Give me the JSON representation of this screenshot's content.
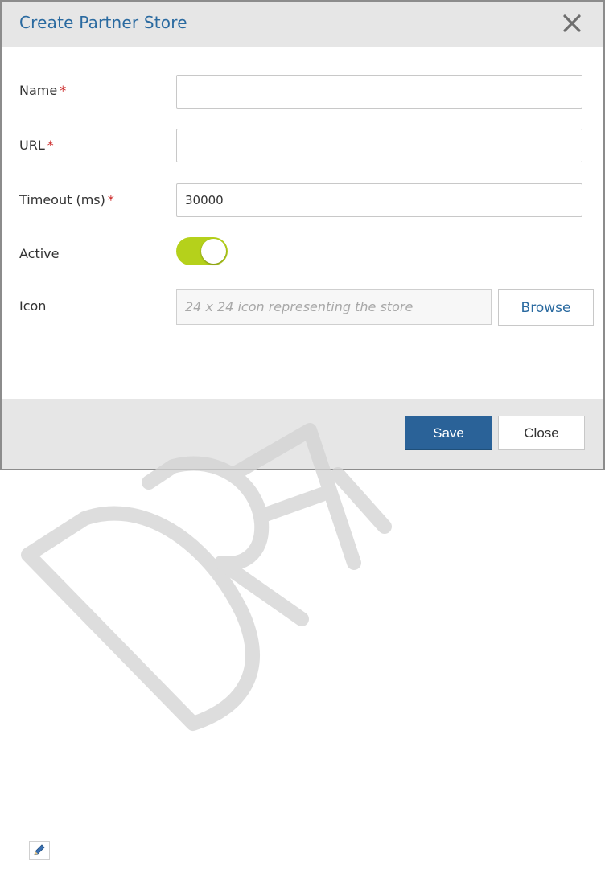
{
  "dialog": {
    "title": "Create Partner Store",
    "close_icon": "close-icon"
  },
  "form": {
    "name": {
      "label": "Name",
      "required_mark": "*",
      "value": ""
    },
    "url": {
      "label": "URL",
      "required_mark": "*",
      "value": ""
    },
    "timeout": {
      "label": "Timeout (ms)",
      "required_mark": "*",
      "value": "30000"
    },
    "active": {
      "label": "Active",
      "checked": true
    },
    "icon": {
      "label": "Icon",
      "placeholder": "24 x 24 icon representing the store",
      "browse_label": "Browse"
    }
  },
  "footer": {
    "save_label": "Save",
    "close_label": "Close"
  },
  "watermark": {
    "text": "DRAFT"
  },
  "edit_icon": "pencil-icon",
  "colors": {
    "title": "#2a6aa0",
    "required": "#cc2a2a",
    "toggle_on": "#b5d11b",
    "primary_button": "#2a6298",
    "header_bg": "#e6e6e6"
  }
}
